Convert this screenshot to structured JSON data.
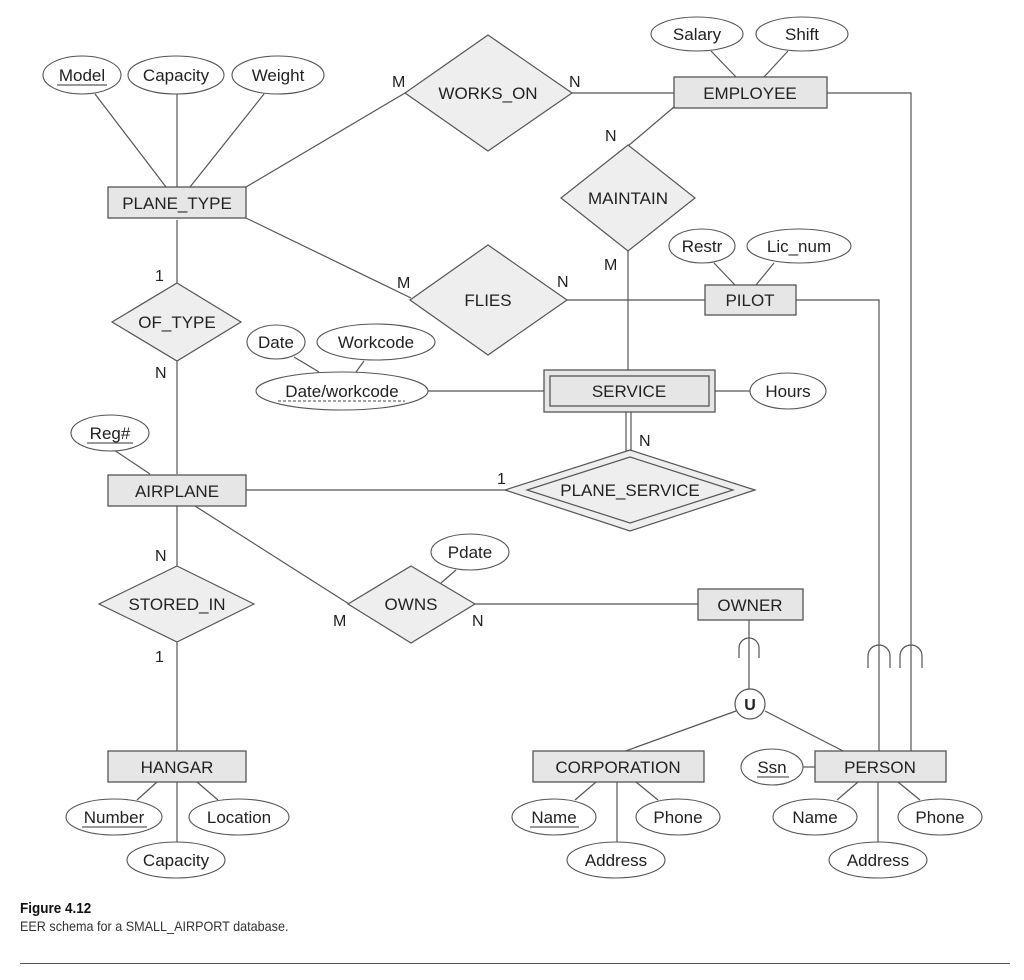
{
  "figure": {
    "label": "Figure 4.12",
    "caption": "EER schema for a SMALL_AIRPORT database."
  },
  "entities": {
    "plane_type": "PLANE_TYPE",
    "employee": "EMPLOYEE",
    "pilot": "PILOT",
    "service": "SERVICE",
    "airplane": "AIRPLANE",
    "owner": "OWNER",
    "hangar": "HANGAR",
    "corporation": "CORPORATION",
    "person": "PERSON"
  },
  "relationships": {
    "works_on": "WORKS_ON",
    "maintain": "MAINTAIN",
    "flies": "FLIES",
    "of_type": "OF_TYPE",
    "plane_service": "PLANE_SERVICE",
    "stored_in": "STORED_IN",
    "owns": "OWNS"
  },
  "attributes": {
    "model": "Model",
    "pt_capacity": "Capacity",
    "weight": "Weight",
    "salary": "Salary",
    "shift": "Shift",
    "restr": "Restr",
    "lic_num": "Lic_num",
    "date": "Date",
    "workcode": "Workcode",
    "date_workcode": "Date/workcode",
    "hours": "Hours",
    "reg": "Reg#",
    "pdate": "Pdate",
    "number": "Number",
    "location": "Location",
    "h_capacity": "Capacity",
    "corp_name": "Name",
    "corp_phone": "Phone",
    "corp_address": "Address",
    "ssn": "Ssn",
    "person_name": "Name",
    "person_phone": "Phone",
    "person_address": "Address"
  },
  "union_symbol": "U",
  "cardinalities": {
    "works_on_m": "M",
    "works_on_n": "N",
    "maintain_n": "N",
    "maintain_m": "M",
    "flies_m": "M",
    "flies_n": "N",
    "of_type_1": "1",
    "of_type_n": "N",
    "plane_service_1": "1",
    "plane_service_n": "N",
    "stored_in_n": "N",
    "stored_in_1": "1",
    "owns_m": "M",
    "owns_n": "N"
  }
}
